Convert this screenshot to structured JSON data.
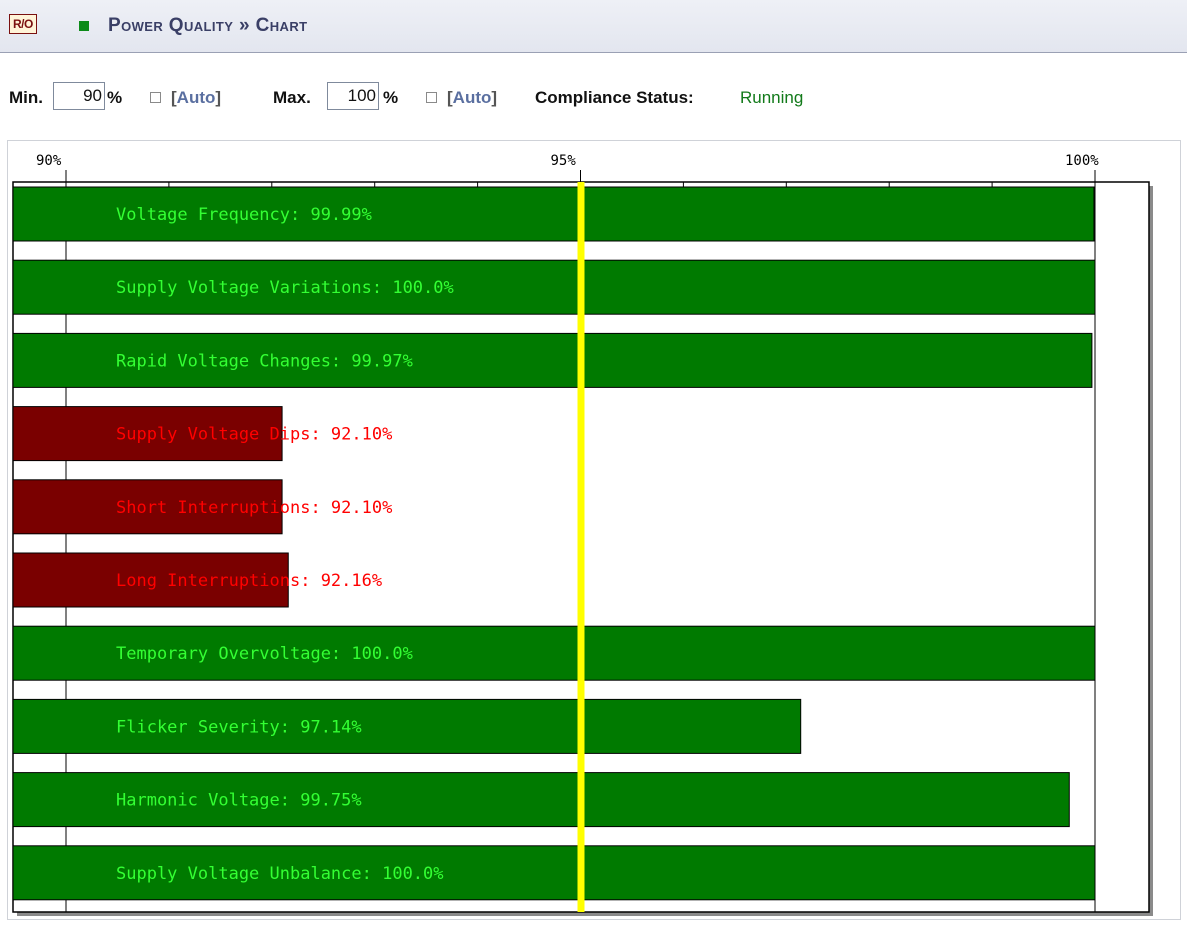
{
  "header": {
    "badge": "R/O",
    "title": "Power Quality » Chart",
    "colors": {
      "title": "#3a3f66",
      "status_square": "#0c8a19"
    }
  },
  "controls": {
    "min_label": "Min.",
    "min_value": "90",
    "min_unit": "%",
    "min_auto_checked": false,
    "max_label": "Max.",
    "max_value": "100",
    "max_unit": "%",
    "max_auto_checked": false,
    "auto_label": "Auto",
    "compliance_label": "Compliance Status:",
    "compliance_value": "Running",
    "compliance_color": "#127a1a"
  },
  "chart_data": {
    "type": "bar",
    "orientation": "horizontal",
    "x_range": [
      90,
      100
    ],
    "threshold": 95,
    "threshold_color": "#ffff00",
    "pass_color": "#007a00",
    "fail_color": "#7a0000",
    "pass_label_color": "#33ff33",
    "fail_label_color": "#ff0000",
    "ticks": [
      {
        "value": 90,
        "label": "90%"
      },
      {
        "value": 95,
        "label": "95%"
      },
      {
        "value": 100,
        "label": "100%"
      }
    ],
    "minor_tick_step": 1,
    "bars": [
      {
        "label": "Voltage Frequency: 99.99%",
        "value": 99.99,
        "status": "pass"
      },
      {
        "label": "Supply Voltage Variations: 100.0%",
        "value": 100.0,
        "status": "pass"
      },
      {
        "label": "Rapid Voltage Changes: 99.97%",
        "value": 99.97,
        "status": "pass"
      },
      {
        "label": "Supply Voltage Dips: 92.10%",
        "value": 92.1,
        "status": "fail"
      },
      {
        "label": "Short Interruptions: 92.10%",
        "value": 92.1,
        "status": "fail"
      },
      {
        "label": "Long Interruptions: 92.16%",
        "value": 92.16,
        "status": "fail"
      },
      {
        "label": "Temporary Overvoltage: 100.0%",
        "value": 100.0,
        "status": "pass"
      },
      {
        "label": "Flicker Severity: 97.14%",
        "value": 97.14,
        "status": "pass"
      },
      {
        "label": "Harmonic Voltage: 99.75%",
        "value": 99.75,
        "status": "pass"
      },
      {
        "label": "Supply Voltage Unbalance: 100.0%",
        "value": 100.0,
        "status": "pass"
      }
    ]
  }
}
